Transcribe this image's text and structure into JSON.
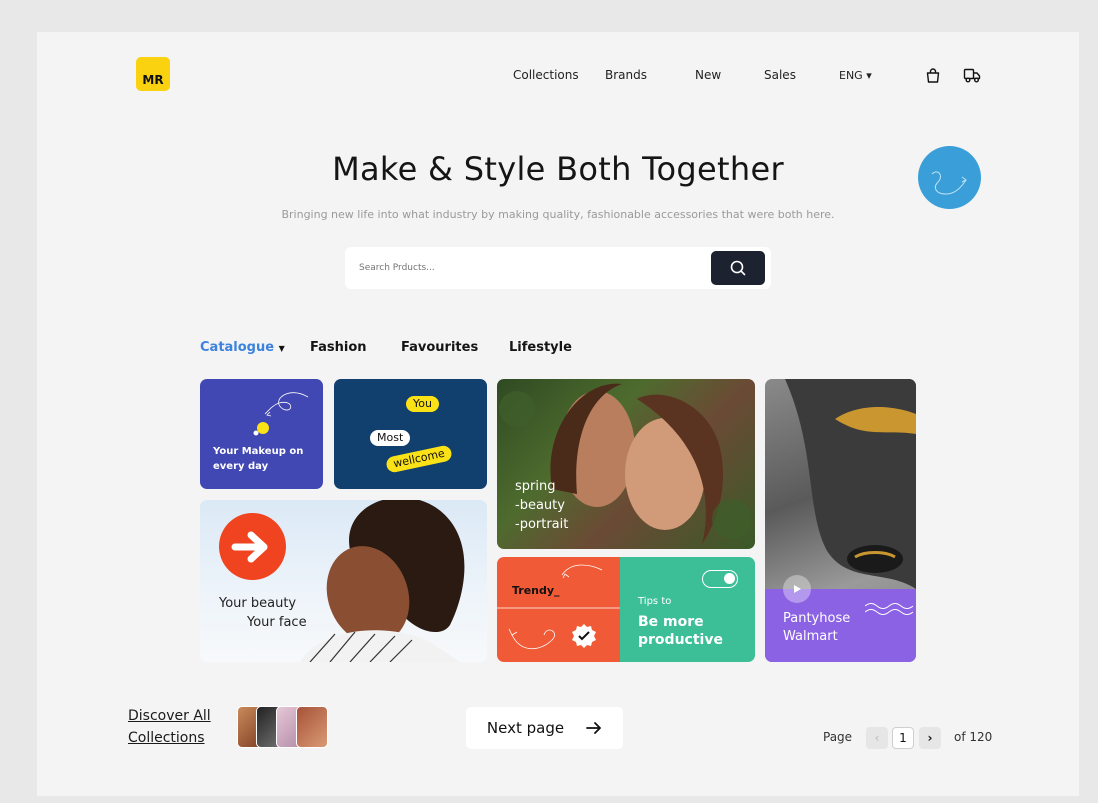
{
  "logo": {
    "text": "MR"
  },
  "nav": {
    "items": [
      "Collections",
      "Brands",
      "New",
      "Sales"
    ],
    "language": "ENG ▾"
  },
  "hero": {
    "title": "Make & Style Both Together",
    "subtitle": "Bringing new life into what industry by making quality, fashionable accessories that were both here."
  },
  "search": {
    "placeholder": "Search Prducts..."
  },
  "tabs": {
    "catalogue": "Catalogue",
    "items": [
      "Fashion",
      "Favourites",
      "Lifestyle"
    ]
  },
  "cards": {
    "makeup": "Your Makeup on every day",
    "welcome": {
      "you": "You",
      "most": "Most",
      "wellcome": "wellcome"
    },
    "portrait": {
      "line1": "spring",
      "line2": "-beauty",
      "line3": "-portrait"
    },
    "beauty": {
      "line1": "Your beauty",
      "line2": "Your face"
    },
    "trendy": "Trendy_",
    "tips": {
      "line1": "Tips to",
      "line2": "Be more",
      "line3": "productive"
    },
    "pantyhose": {
      "line1": "Pantyhose",
      "line2": "Walmart"
    }
  },
  "footer": {
    "discover": {
      "line1": "Discover All",
      "line2": "Collections"
    },
    "next_page": "Next page",
    "pagination": {
      "page_label": "Page",
      "current": "1",
      "total": "of 120"
    }
  },
  "colors": {
    "accent": "#3d82dc",
    "logo": "#fbd20f",
    "card_indigo": "#4147b3",
    "card_navy": "#113f6e",
    "card_orange": "#f05a36",
    "card_teal": "#3cbf97",
    "card_purple": "#8b62e3"
  },
  "icons": [
    "shopping-bag-icon",
    "delivery-truck-icon",
    "search-icon",
    "arrow-right-icon",
    "checkmark-badge-icon",
    "toggle-icon",
    "play-icon"
  ]
}
